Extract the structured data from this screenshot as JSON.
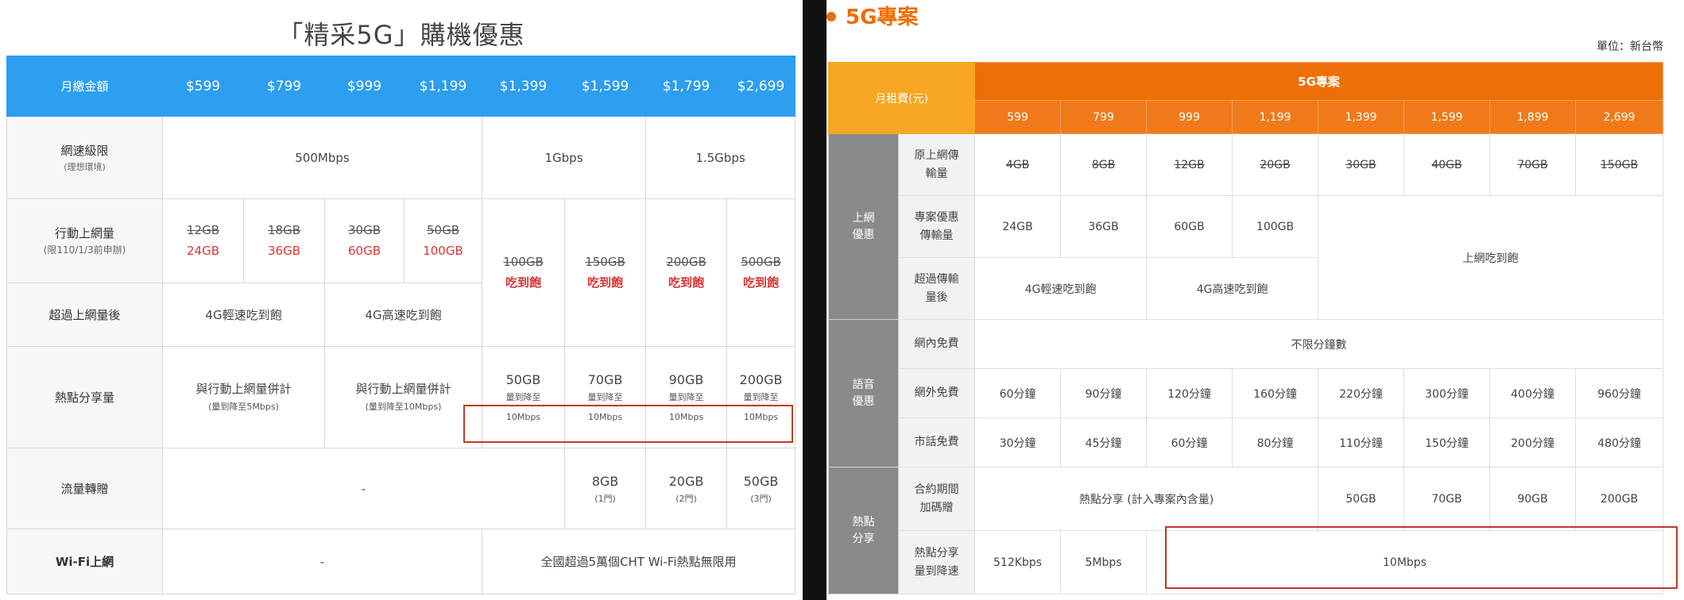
{
  "left": {
    "title": "「精采5G」購機優惠",
    "header": {
      "label": "月繳金額",
      "prices": [
        "$599",
        "$799",
        "$999",
        "$1,199",
        "$1,399",
        "$1,599",
        "$1,799",
        "$2,699"
      ]
    },
    "speed_limit": {
      "label": "網速級限",
      "sublabel": "(理想環境)",
      "v1": "500Mbps",
      "v2": "1Gbps",
      "v3": "1.5Gbps"
    },
    "mobile_data": {
      "label": "行動上網量",
      "sublabel": "(限110/1/3前申辦)",
      "old": [
        "12GB",
        "18GB",
        "30GB",
        "50GB"
      ],
      "new": [
        "24GB",
        "36GB",
        "60GB",
        "100GB"
      ],
      "unl_old": [
        "100GB",
        "150GB",
        "200GB",
        "500GB"
      ],
      "unl_text": "吃到飽"
    },
    "after_limit": {
      "label": "超過上網量後",
      "v1": "4G輕速吃到飽",
      "v2": "4G高速吃到飽"
    },
    "hotspot": {
      "label": "熱點分享量",
      "c1_main": "與行動上網量併計",
      "c1_sub": "(量到降至5Mbps)",
      "c2_main": "與行動上網量併計",
      "c2_sub": "(量到降至10Mbps)",
      "amounts": [
        "50GB",
        "70GB",
        "90GB",
        "200GB"
      ],
      "reduce": "量到降至",
      "speed": "10Mbps"
    },
    "transfer": {
      "label": "流量轉贈",
      "none": "-",
      "vals": [
        "8GB",
        "20GB",
        "50GB"
      ],
      "subs": [
        "(1門)",
        "(2門)",
        "(3門)"
      ]
    },
    "wifi": {
      "label": "Wi-Fi上網",
      "none": "-",
      "text": "全國超過5萬個CHT Wi-Fi熱點無限用"
    }
  },
  "right": {
    "title": "5G專案",
    "unit": "單位：新台幣",
    "fee_label": "月租費(元)",
    "plan_label": "5G專案",
    "prices": [
      "599",
      "799",
      "999",
      "1,199",
      "1,399",
      "1,599",
      "1,899",
      "2,699"
    ],
    "internet": {
      "cat": "上網優惠",
      "orig_label": "原上網傳輸量",
      "orig": [
        "4GB",
        "8GB",
        "12GB",
        "20GB",
        "30GB",
        "40GB",
        "70GB",
        "150GB"
      ],
      "promo_label": "專案優惠傳輸量",
      "promo": [
        "24GB",
        "36GB",
        "60GB",
        "100GB"
      ],
      "unl": "上網吃到飽",
      "over_label": "超過傳輸量後",
      "over1": "4G輕速吃到飽",
      "over2": "4G高速吃到飽"
    },
    "voice": {
      "cat": "語音優惠",
      "onnet_label": "網內免費",
      "onnet": "不限分鐘數",
      "offnet_label": "網外免費",
      "offnet": [
        "60分鐘",
        "90分鐘",
        "120分鐘",
        "160分鐘",
        "220分鐘",
        "300分鐘",
        "400分鐘",
        "960分鐘"
      ],
      "local_label": "市話免費",
      "local": [
        "30分鐘",
        "45分鐘",
        "60分鐘",
        "80分鐘",
        "110分鐘",
        "150分鐘",
        "200分鐘",
        "480分鐘"
      ]
    },
    "hotspot": {
      "cat": "熱點分享",
      "bonus_label": "合約期間加碼贈",
      "bonus_text": "熱點分享 (計入專案內含量)",
      "bonus": [
        "50GB",
        "70GB",
        "90GB",
        "200GB"
      ],
      "speed_label": "熱點分享量到降速",
      "speed1": "512Kbps",
      "speed2": "5Mbps",
      "speed3": "10Mbps"
    }
  }
}
